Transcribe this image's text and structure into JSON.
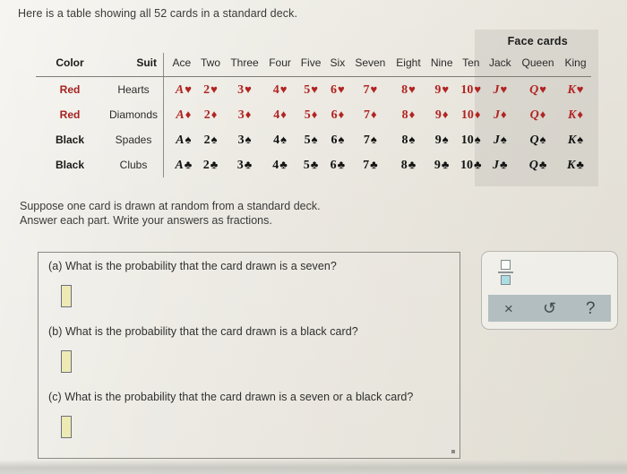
{
  "intro": "Here is a table showing all 52 cards in a standard deck.",
  "table": {
    "group_header": "Face cards",
    "headers": {
      "color": "Color",
      "suit": "Suit",
      "ranks": [
        "Ace",
        "Two",
        "Three",
        "Four",
        "Five",
        "Six",
        "Seven",
        "Eight",
        "Nine",
        "Ten",
        "Jack",
        "Queen",
        "King"
      ]
    },
    "rank_symbols": [
      "A",
      "2",
      "3",
      "4",
      "5",
      "6",
      "7",
      "8",
      "9",
      "10",
      "J",
      "Q",
      "K"
    ],
    "rows": [
      {
        "color": "Red",
        "suit": "Hearts",
        "pip": "♥",
        "color_class": "red",
        "row_class": "red-row"
      },
      {
        "color": "Red",
        "suit": "Diamonds",
        "pip": "♦",
        "color_class": "red",
        "row_class": "red-row"
      },
      {
        "color": "Black",
        "suit": "Spades",
        "pip": "♠",
        "color_class": "black",
        "row_class": "black-row"
      },
      {
        "color": "Black",
        "suit": "Clubs",
        "pip": "♣",
        "color_class": "black",
        "row_class": "black-row"
      }
    ]
  },
  "prompt": {
    "line1": "Suppose one card is drawn at random from a standard deck.",
    "line2": "Answer each part. Write your answers as fractions."
  },
  "questions": [
    {
      "label": "(a) What is the probability that the card drawn is a seven?",
      "value": ""
    },
    {
      "label": "(b) What is the probability that the card drawn is a black card?",
      "value": ""
    },
    {
      "label": "(c) What is the probability that the card drawn is a seven or a black card?",
      "value": ""
    }
  ],
  "toolbar": {
    "fraction_icon": "fraction-template-icon",
    "buttons": [
      {
        "name": "clear-button",
        "glyph": "×",
        "class": "clear"
      },
      {
        "name": "undo-button",
        "glyph": "↺",
        "class": "undo"
      },
      {
        "name": "help-button",
        "glyph": "?",
        "class": "help"
      }
    ]
  },
  "colors": {
    "red_suit": "#b12423",
    "black_suit": "#131313",
    "answer_box_fill": "#edeab4",
    "toolbar_bar": "#b2bebf",
    "selected_slot": "#addde2"
  }
}
